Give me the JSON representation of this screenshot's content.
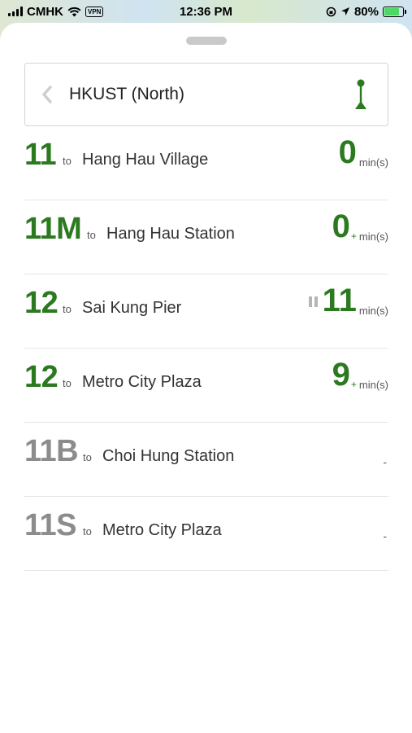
{
  "status_bar": {
    "carrier": "CMHK",
    "vpn": "VPN",
    "time": "12:36 PM",
    "battery": "80%",
    "battery_level": 0.8
  },
  "stop": {
    "name": "HKUST (North)"
  },
  "routes": [
    {
      "number": "11",
      "to": "to",
      "destination": "Hang Hau Village",
      "eta": "0",
      "plus": "",
      "unit": "min(s)",
      "active": true,
      "paused": false
    },
    {
      "number": "11M",
      "to": "to",
      "destination": "Hang Hau Station",
      "eta": "0",
      "plus": "+",
      "unit": "min(s)",
      "active": true,
      "paused": false
    },
    {
      "number": "12",
      "to": "to",
      "destination": "Sai Kung Pier",
      "eta": "11",
      "plus": "",
      "unit": "min(s)",
      "active": true,
      "paused": true
    },
    {
      "number": "12",
      "to": "to",
      "destination": "Metro City Plaza",
      "eta": "9",
      "plus": "+",
      "unit": "min(s)",
      "active": true,
      "paused": false
    },
    {
      "number": "11B",
      "to": "to",
      "destination": "Choi Hung Station",
      "eta": "-",
      "plus": "",
      "unit": "",
      "active": false,
      "paused": false
    },
    {
      "number": "11S",
      "to": "to",
      "destination": "Metro City Plaza",
      "eta": "-",
      "plus": "",
      "unit": "",
      "active": false,
      "paused": false
    }
  ],
  "colors": {
    "accent_green": "#2b7a1f",
    "inactive_grey": "#8c8c8c"
  },
  "icons": {
    "back": "chevron-left-icon",
    "map_pin": "map-pin-icon",
    "paused": "pause-icon"
  }
}
